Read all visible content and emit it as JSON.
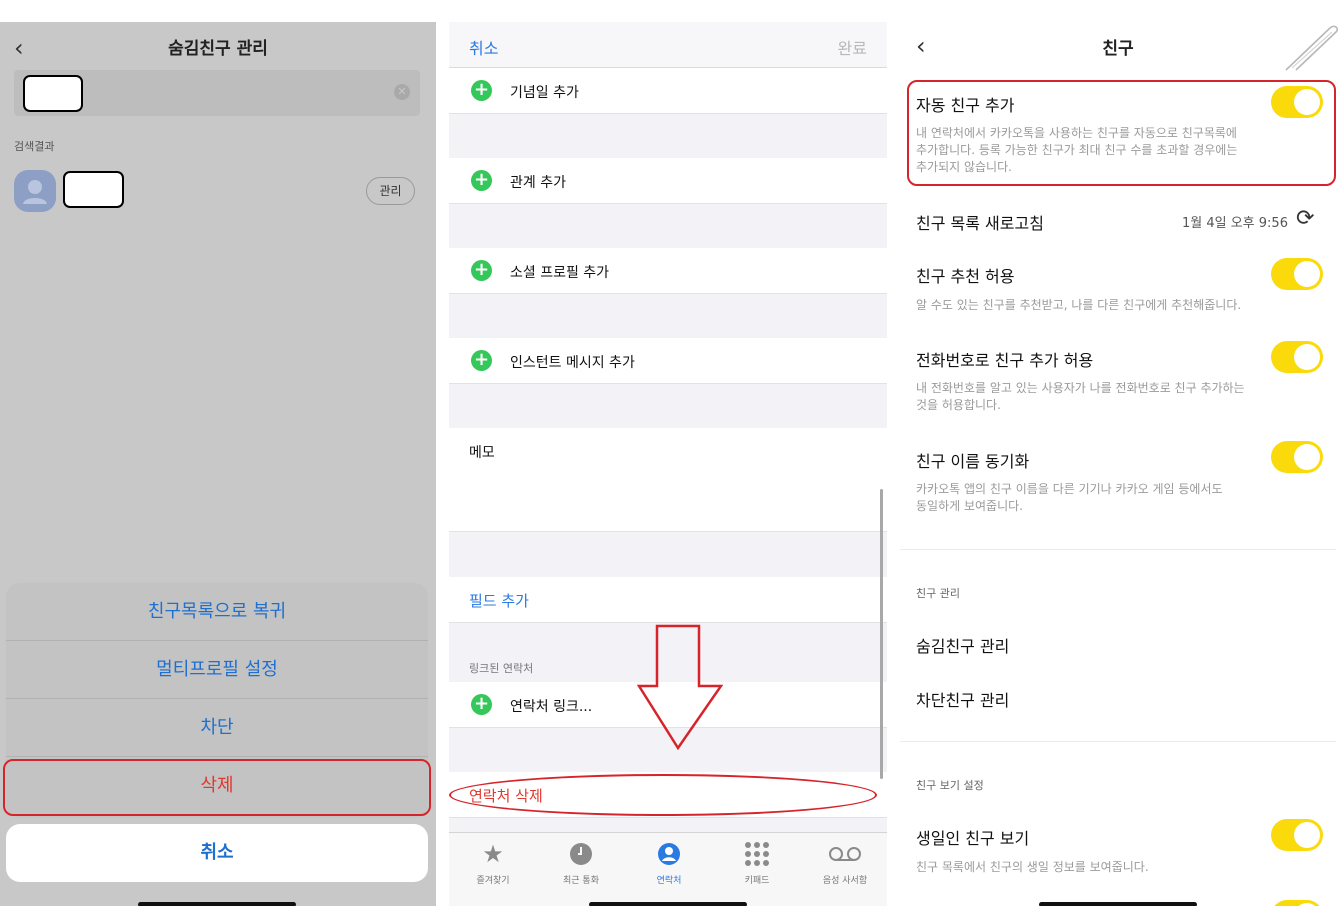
{
  "hidden_friends": {
    "title": "숨김친구 관리",
    "results_label": "검색결과",
    "manage_label": "관리",
    "actions": [
      "친구목록으로 복귀",
      "멀티프로필 설정",
      "차단",
      "삭제"
    ],
    "cancel_label": "취소"
  },
  "contact_edit": {
    "cancel_label": "취소",
    "done_label": "완료",
    "add_rows": [
      "기념일 추가",
      "관계 추가",
      "소셜 프로필 추가",
      "인스턴트 메시지 추가"
    ],
    "memo_label": "메모",
    "add_field_label": "필드 추가",
    "linked_header": "링크된 연락처",
    "link_contact_label": "연락처 링크...",
    "delete_contact_label": "연락처 삭제",
    "tabs": [
      {
        "icon": "star-icon",
        "label": "즐겨찾기"
      },
      {
        "icon": "clock-icon",
        "label": "최근 통화"
      },
      {
        "icon": "person-circle-icon",
        "label": "연락처"
      },
      {
        "icon": "keypad-icon",
        "label": "키패드"
      },
      {
        "icon": "voicemail-icon",
        "label": "음성 사서함"
      }
    ],
    "active_tab": "연락처"
  },
  "friend_settings": {
    "title": "친구",
    "auto_add": {
      "title": "자동 친구 추가",
      "desc_line1": "내 연락처에서 카카오톡을 사용하는 친구를 자동으로 친구목록에",
      "desc_line2": "추가합니다. 등록 가능한 친구가 최대 친구 수를 초과할 경우에는",
      "desc_line3": "추가되지 않습니다.",
      "enabled": true
    },
    "refresh": {
      "title": "친구 목록 새로고침",
      "timestamp": "1월 4일 오후 9:56"
    },
    "recommend": {
      "title": "친구 추천 허용",
      "desc": "알 수도 있는 친구를 추천받고, 나를 다른 친구에게 추천해줍니다.",
      "enabled": true
    },
    "phone_add": {
      "title": "전화번호로 친구 추가 허용",
      "desc_line1": "내 전화번호를 알고 있는 사용자가 나를 전화번호로 친구 추가하는",
      "desc_line2": "것을 허용합니다.",
      "enabled": true
    },
    "name_sync": {
      "title": "친구 이름 동기화",
      "desc_line1": "카카오톡 앱의 친구 이름을 다른 기기나 카카오 게임 등에서도",
      "desc_line2": "동일하게 보여줍니다.",
      "enabled": true
    },
    "manage_header": "친구 관리",
    "hidden_friends_label": "숨김친구 관리",
    "blocked_friends_label": "차단친구 관리",
    "view_header": "친구 보기 설정",
    "birthday": {
      "title": "생일인 친구 보기",
      "desc": "친구 목록에서 친구의 생일 정보를 보여줍니다.",
      "enabled": true
    }
  },
  "colors": {
    "toggle_on": "#fada0a",
    "highlight_red": "#d6242b",
    "ios_blue": "#2a7ae2",
    "plus_green": "#34c759"
  }
}
